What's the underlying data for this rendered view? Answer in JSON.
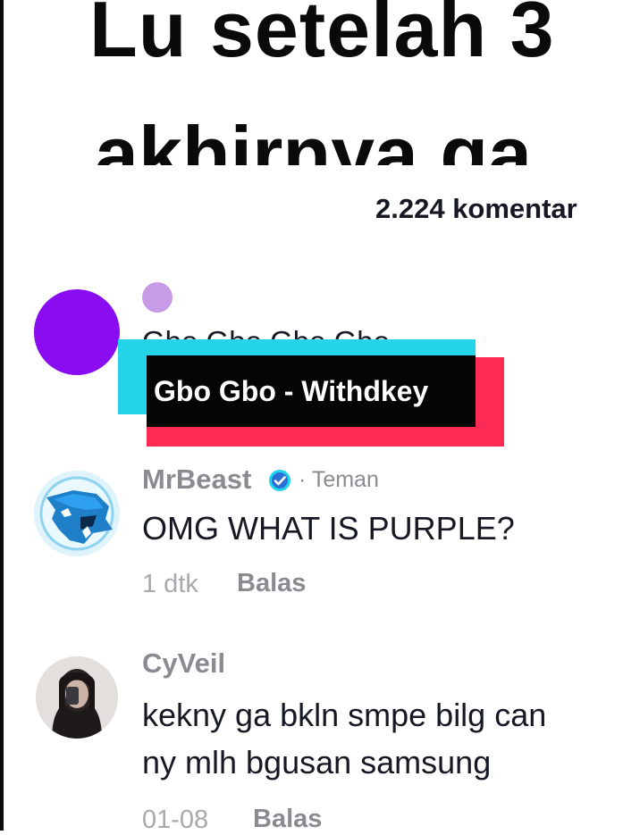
{
  "video": {
    "caption_line1": "Lu setelah 3",
    "caption_line2": "akhirnya ga"
  },
  "comments_header": {
    "count_label": "2.224 komentar"
  },
  "song_tag": {
    "title": "Gbo Gbo - Withdkey"
  },
  "comments": [
    {
      "username": "",
      "text": "Gbo Gbo Gbo Gbo",
      "avatar_color": "#8a0cf0"
    },
    {
      "username": "MrBeast",
      "verified": true,
      "relation": "· Teman",
      "text": "OMG WHAT IS PURPLE?",
      "time": "1 dtk",
      "reply_label": "Balas"
    },
    {
      "username": "CyVeil",
      "text_line1": "kekny ga bkln smpe bilg can",
      "text_line2": "ny mlh bgusan samsung",
      "time": "01-08",
      "reply_label": "Balas"
    }
  ],
  "colors": {
    "accent_cyan": "#25d4e8",
    "accent_red": "#fe2c55",
    "verified_blue": "#20d5ec"
  }
}
